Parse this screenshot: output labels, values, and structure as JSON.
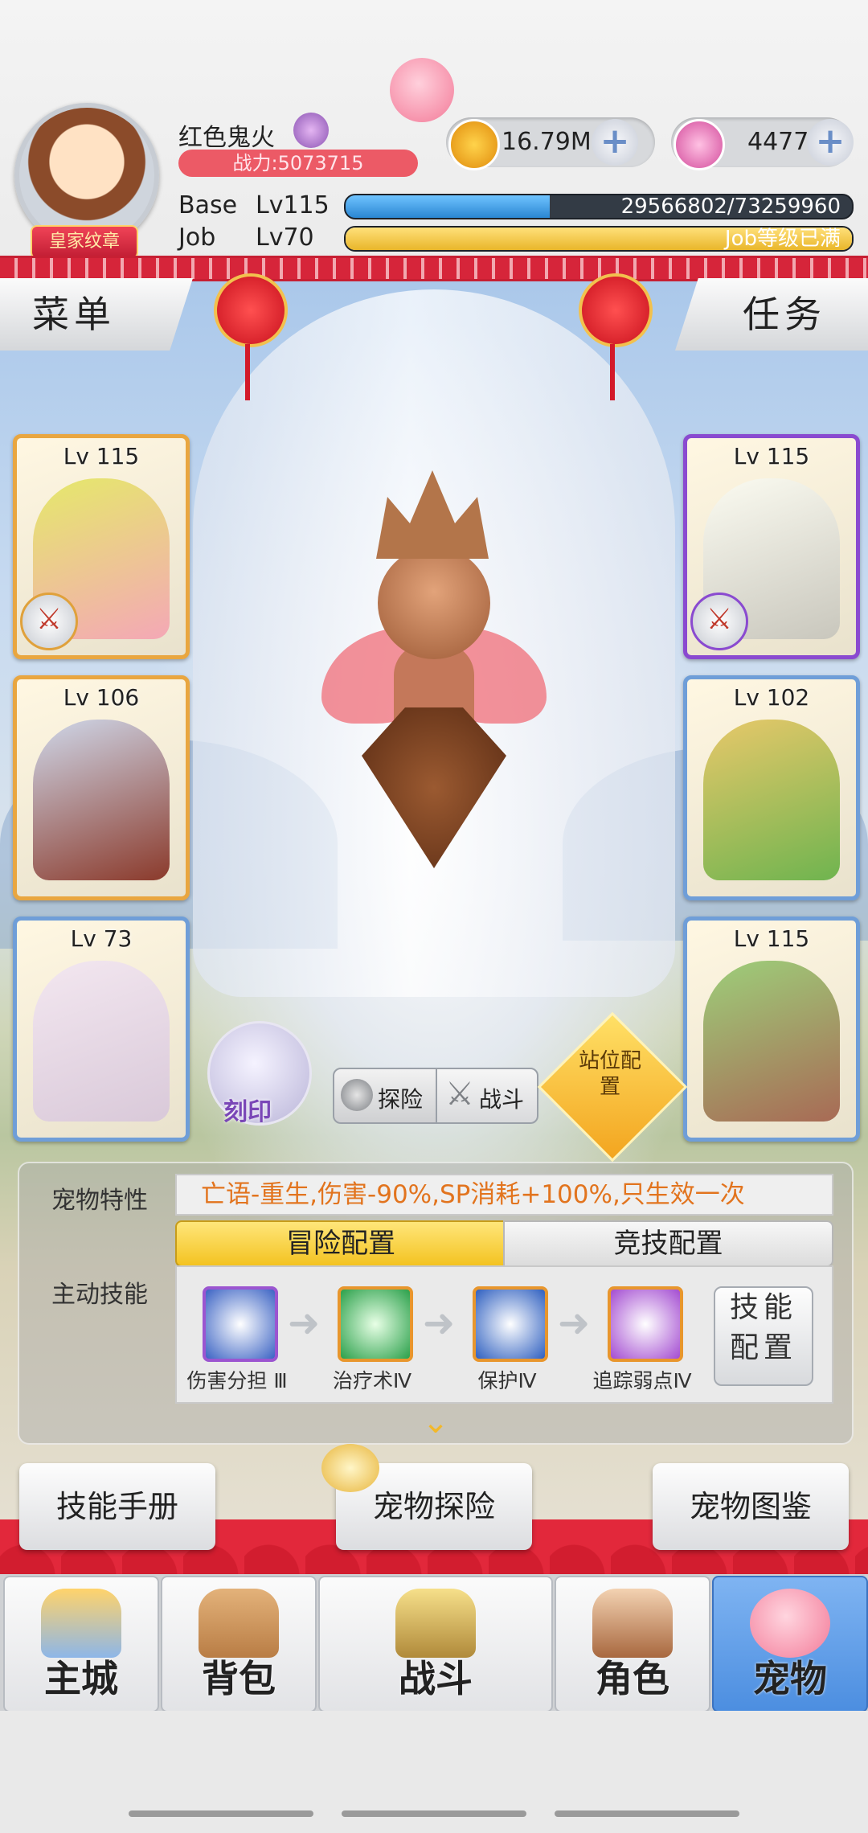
{
  "player": {
    "name": "红色鬼火",
    "power": "战力:5073715",
    "badge": "皇家纹章"
  },
  "currency": {
    "zeny": "16.79M",
    "gems": "4477"
  },
  "progress": {
    "base_label": "Base",
    "base_level": "Lv115",
    "base_exp": "29566802/73259960",
    "base_fraction": 0.4036,
    "job_label": "Job",
    "job_level": "Lv70",
    "job_text": "Job等级已满",
    "job_fraction": 1.0
  },
  "side_buttons": {
    "menu": "菜单",
    "quest": "任务"
  },
  "cards_left": [
    {
      "level": "Lv 115"
    },
    {
      "level": "Lv 106"
    },
    {
      "level": "Lv 73"
    }
  ],
  "cards_right": [
    {
      "level": "Lv 115"
    },
    {
      "level": "Lv 102"
    },
    {
      "level": "Lv 115"
    }
  ],
  "actions": {
    "seal": "刻印",
    "explore": "探险",
    "fight": "战斗",
    "formation": "站位配置"
  },
  "pet_panel": {
    "trait_label": "宠物特性",
    "trait_text": "亡语-重生,伤害-90%,SP消耗+100%,只生效一次",
    "active_skill_label": "主动技能",
    "tab_adventure": "冒险配置",
    "tab_arena": "竞技配置",
    "skills": [
      {
        "name": "伤害分担 Ⅲ",
        "icon": "shield-share-icon",
        "color": "#3b63c4"
      },
      {
        "name": "治疗术Ⅳ",
        "icon": "heal-icon",
        "color": "#2aa04a"
      },
      {
        "name": "保护Ⅳ",
        "icon": "protect-icon",
        "color": "#2e5fc0"
      },
      {
        "name": "追踪弱点Ⅳ",
        "icon": "track-weakness-icon",
        "color": "#a34bd1"
      }
    ],
    "skill_config": "技能配置"
  },
  "bottom_actions": {
    "skill_manual": "技能手册",
    "pet_explore": "宠物探险",
    "pet_encyclopedia": "宠物图鉴"
  },
  "nav": {
    "city": "主城",
    "bag": "背包",
    "battle": "战斗",
    "character": "角色",
    "pet": "宠物"
  },
  "colors": {
    "power_bar": "#ec5a66",
    "base_bar": "#3a9ce0",
    "job_bar": "#f2c94a",
    "active_nav": "#4c8ee0",
    "trait_text": "#e2741e"
  }
}
